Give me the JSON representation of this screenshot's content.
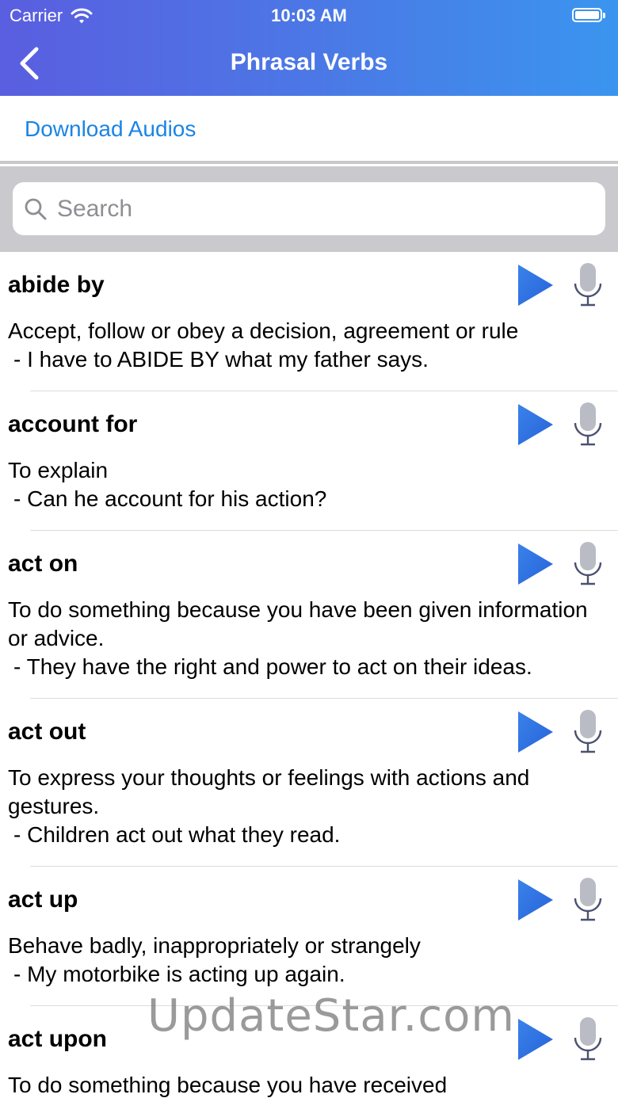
{
  "status_bar": {
    "carrier": "Carrier",
    "time": "10:03 AM"
  },
  "nav": {
    "title": "Phrasal Verbs",
    "back_icon": "chevron-left-icon"
  },
  "download": {
    "label": "Download Audios"
  },
  "search": {
    "placeholder": "Search",
    "value": ""
  },
  "items": [
    {
      "term": "abide by",
      "definition": "Accept, follow or obey a decision, agreement or rule",
      "example": "- I have to ABIDE BY what my father says."
    },
    {
      "term": "account for",
      "definition": "To explain",
      "example": "- Can he account for his action?"
    },
    {
      "term": "act on",
      "definition": "To do something because you have been given information or advice.",
      "example": "- They have the right and power to act on their ideas."
    },
    {
      "term": "act out",
      "definition": "To express your thoughts or feelings with actions and gestures.",
      "example": "- Children act out what they read."
    },
    {
      "term": "act up",
      "definition": "Behave badly,  inappropriately or strangely",
      "example": "- My motorbike is acting up again."
    },
    {
      "term": "act upon",
      "definition": "To do something because you have received",
      "example": ""
    }
  ],
  "watermark": "UpdateStar.com",
  "colors": {
    "header_start": "#5a5ee0",
    "header_end": "#3a95ef",
    "link": "#1a84e6",
    "play": "#2a6fe0"
  }
}
